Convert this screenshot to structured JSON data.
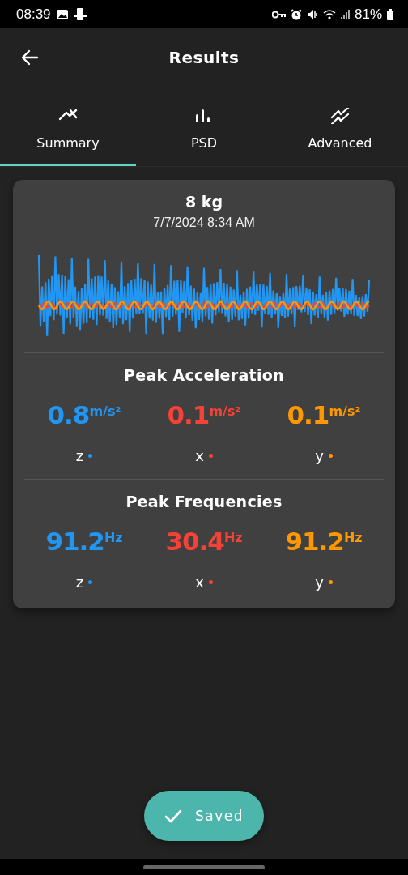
{
  "status_bar": {
    "time": "08:39",
    "battery": "81%"
  },
  "header": {
    "title": "Results"
  },
  "tabs": [
    {
      "label": "Summary",
      "selected": true
    },
    {
      "label": "PSD",
      "selected": false
    },
    {
      "label": "Advanced",
      "selected": false
    }
  ],
  "result": {
    "title": "8 kg",
    "date": "7/7/2024 8:34 AM",
    "sections": [
      {
        "title": "Peak Acceleration",
        "metrics": [
          {
            "value": "0.8",
            "unit": "m/s²",
            "axis": "z",
            "color": "#2196f3"
          },
          {
            "value": "0.1",
            "unit": "m/s²",
            "axis": "x",
            "color": "#f44336"
          },
          {
            "value": "0.1",
            "unit": "m/s²",
            "axis": "y",
            "color": "#ff9800"
          }
        ]
      },
      {
        "title": "Peak Frequencies",
        "metrics": [
          {
            "value": "91.2",
            "unit": "Hz",
            "axis": "z",
            "color": "#2196f3"
          },
          {
            "value": "30.4",
            "unit": "Hz",
            "axis": "x",
            "color": "#f44336"
          },
          {
            "value": "91.2",
            "unit": "Hz",
            "axis": "y",
            "color": "#ff9800"
          }
        ]
      }
    ]
  },
  "saved_button": {
    "label": "Saved"
  }
}
